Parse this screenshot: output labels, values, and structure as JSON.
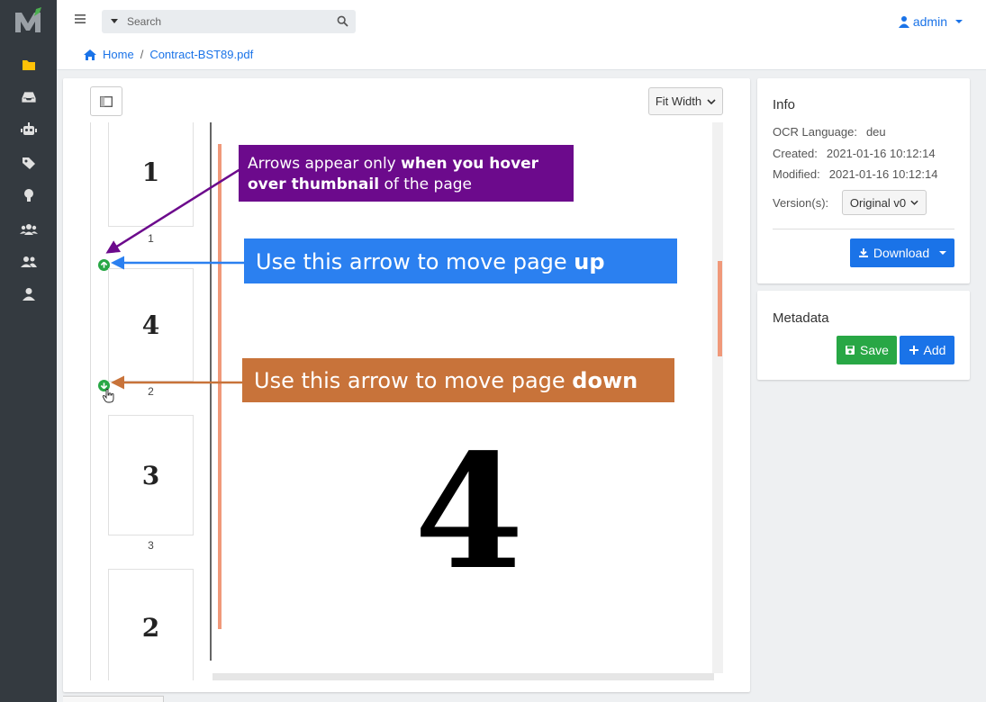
{
  "search": {
    "placeholder": "Search"
  },
  "user": {
    "name": "admin"
  },
  "breadcrumb": {
    "home": "Home",
    "document": "Contract-BST89.pdf"
  },
  "sidebar": {
    "items": [
      {
        "icon": "folder-icon"
      },
      {
        "icon": "inbox-icon"
      },
      {
        "icon": "robot-icon"
      },
      {
        "icon": "tag-icon"
      },
      {
        "icon": "lightbulb-icon"
      },
      {
        "icon": "users-icon"
      },
      {
        "icon": "user-friends-icon"
      },
      {
        "icon": "user-icon"
      }
    ]
  },
  "toolbar": {
    "fit_label": "Fit Width"
  },
  "thumbnails": [
    {
      "page_label": "1",
      "number": "1"
    },
    {
      "page_label": "4",
      "number": "2"
    },
    {
      "page_label": "3",
      "number": "3"
    },
    {
      "page_label": "2",
      "number": ""
    }
  ],
  "viewer": {
    "current_page": "4"
  },
  "info": {
    "title": "Info",
    "ocr_label": "OCR Language:",
    "ocr_value": "deu",
    "created_label": "Created:",
    "created_value": "2021-01-16 10:12:14",
    "modified_label": "Modified:",
    "modified_value": "2021-01-16 10:12:14",
    "version_label": "Version(s):",
    "version_value": "Original v0",
    "download_label": "Download"
  },
  "metadata": {
    "title": "Metadata",
    "save_label": "Save",
    "add_label": "Add"
  },
  "callouts": {
    "hover_a": "Arrows appear only ",
    "hover_b": "when you hover",
    "hover_c": "over thumbnail",
    "hover_d": " of the page",
    "up_a": "Use this arrow to move page ",
    "up_b": "up",
    "down_a": "Use this arrow to move page ",
    "down_b": "down"
  },
  "colors": {
    "accent": "#1a73e8",
    "success": "#28a745",
    "sidebar": "#343a40",
    "logo_accent": "#4caf50",
    "active_nav": "#ffc107",
    "callout_purple": "#6c0a8c",
    "callout_blue": "#2b80f0",
    "callout_orange": "#c8733a",
    "highlight_orange": "#f0997a"
  }
}
